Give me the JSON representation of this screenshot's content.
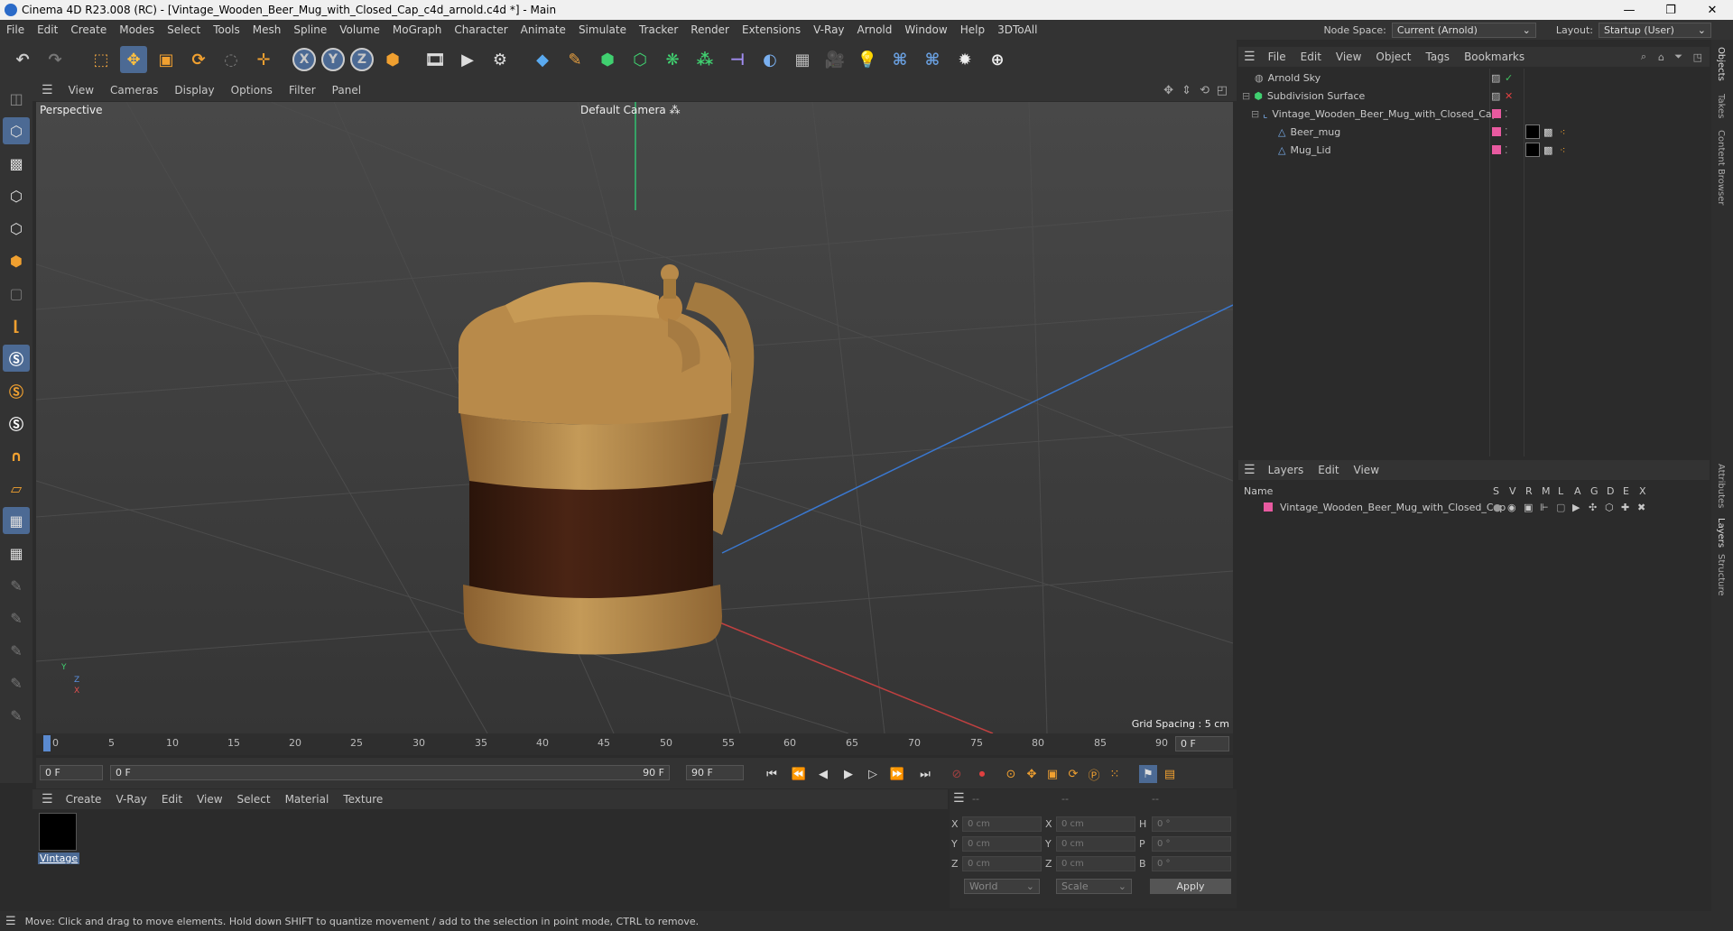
{
  "window": {
    "title": "Cinema 4D R23.008 (RC) - [Vintage_Wooden_Beer_Mug_with_Closed_Cap_c4d_arnold.c4d *] - Main",
    "minimize": "—",
    "maximize": "❐",
    "close": "✕"
  },
  "menubar": {
    "items": [
      "File",
      "Edit",
      "Create",
      "Modes",
      "Select",
      "Tools",
      "Mesh",
      "Spline",
      "Volume",
      "MoGraph",
      "Character",
      "Animate",
      "Simulate",
      "Tracker",
      "Render",
      "Extensions",
      "V-Ray",
      "Arnold",
      "Window",
      "Help",
      "3DToAll"
    ],
    "node_space_label": "Node Space:",
    "node_space_value": "Current (Arnold)",
    "layout_label": "Layout:",
    "layout_value": "Startup (User)"
  },
  "toolbar": {
    "axis_x": "X",
    "axis_y": "Y",
    "axis_z": "Z"
  },
  "viewport": {
    "menu": [
      "View",
      "Cameras",
      "Display",
      "Options",
      "Filter",
      "Panel"
    ],
    "label": "Perspective",
    "camera": "Default Camera",
    "grid_spacing": "Grid Spacing : 5 cm",
    "axis_y": "Y",
    "axis_z": "Z",
    "axis_x": "X"
  },
  "timeline": {
    "ticks": [
      "0",
      "5",
      "10",
      "15",
      "20",
      "25",
      "30",
      "35",
      "40",
      "45",
      "50",
      "55",
      "60",
      "65",
      "70",
      "75",
      "80",
      "85",
      "90"
    ],
    "frame_right": "0 F"
  },
  "anim": {
    "start": "0 F",
    "range_start": "0 F",
    "range_end": "90 F",
    "end": "90 F"
  },
  "material_panel": {
    "menu": [
      "Create",
      "V-Ray",
      "Edit",
      "View",
      "Select",
      "Material",
      "Texture"
    ],
    "material_name": "Vintage"
  },
  "coords": {
    "header": [
      "--",
      "--",
      "--"
    ],
    "rows": [
      {
        "l1": "X",
        "v1": "0 cm",
        "l2": "X",
        "v2": "0 cm",
        "l3": "H",
        "v3": "0 °"
      },
      {
        "l1": "Y",
        "v1": "0 cm",
        "l2": "Y",
        "v2": "0 cm",
        "l3": "P",
        "v3": "0 °"
      },
      {
        "l1": "Z",
        "v1": "0 cm",
        "l2": "Z",
        "v2": "0 cm",
        "l3": "B",
        "v3": "0 °"
      }
    ],
    "world": "World",
    "scale": "Scale",
    "apply": "Apply"
  },
  "status": "Move: Click and drag to move elements. Hold down SHIFT to quantize movement / add to the selection in point mode, CTRL to remove.",
  "objects": {
    "menu": [
      "File",
      "Edit",
      "View",
      "Object",
      "Tags",
      "Bookmarks"
    ],
    "items": [
      {
        "name": "Arnold Sky"
      },
      {
        "name": "Subdivision Surface"
      },
      {
        "name": "Vintage_Wooden_Beer_Mug_with_Closed_Cap"
      },
      {
        "name": "Beer_mug"
      },
      {
        "name": "Mug_Lid"
      }
    ]
  },
  "layers": {
    "menu": [
      "Layers",
      "Edit",
      "View"
    ],
    "name_col": "Name",
    "cols": [
      "S",
      "V",
      "R",
      "M",
      "L",
      "A",
      "G",
      "D",
      "E",
      "X"
    ],
    "items": [
      {
        "name": "Vintage_Wooden_Beer_Mug_with_Closed_Cap"
      }
    ]
  },
  "right_tabs": [
    "Objects",
    "Takes",
    "Content Browser",
    "Attributes",
    "Layers",
    "Structure"
  ],
  "colors": {
    "accent": "#4c6a94",
    "layer_pink": "#e85aa0",
    "mug_wood": "#b88a4a",
    "mug_dark": "#3a1e10"
  }
}
